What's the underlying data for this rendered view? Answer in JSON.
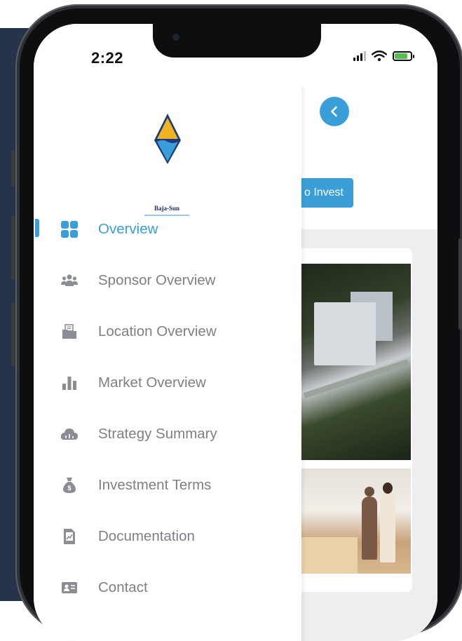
{
  "status": {
    "time": "2:22"
  },
  "background_app": {
    "invest_button_label": "o Invest"
  },
  "drawer": {
    "logo": {
      "brand": "Baja-Sun"
    },
    "menu": [
      {
        "label": "Overview",
        "icon": "grid-icon",
        "active": true
      },
      {
        "label": "Sponsor Overview",
        "icon": "users-icon",
        "active": false
      },
      {
        "label": "Location Overview",
        "icon": "folder-icon",
        "active": false
      },
      {
        "label": "Market Overview",
        "icon": "bar-chart-icon",
        "active": false
      },
      {
        "label": "Strategy Summary",
        "icon": "cloud-icon",
        "active": false
      },
      {
        "label": "Investment Terms",
        "icon": "money-bag-icon",
        "active": false
      },
      {
        "label": "Documentation",
        "icon": "document-chart-icon",
        "active": false
      },
      {
        "label": "Contact",
        "icon": "contact-card-icon",
        "active": false
      }
    ]
  },
  "colors": {
    "accent": "#3a9fd8",
    "menu_text": "#7d8087",
    "left_panel": "#263349"
  }
}
